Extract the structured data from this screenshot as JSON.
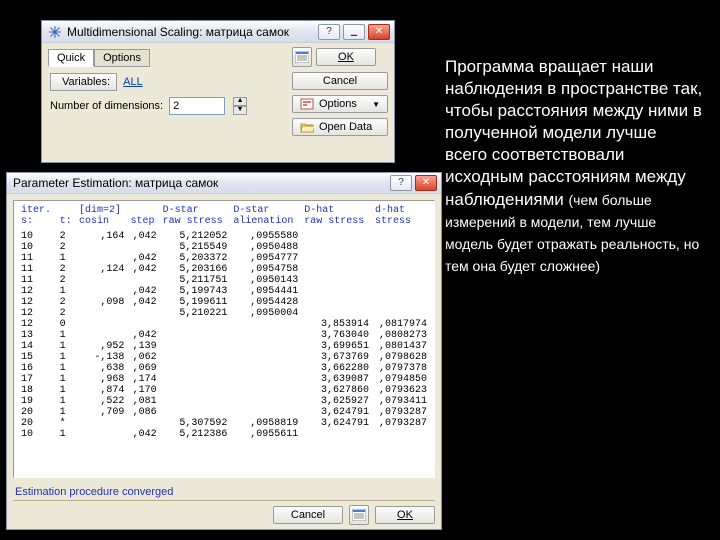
{
  "slide": {
    "text_main": "Программа вращает наши наблюдения в пространстве так, чтобы расстояния между ними в полученной модели лучше всего соответствовали исходным расстояниям между наблюдениями ",
    "text_small": "(чем больше измерений в модели, тем лучше модель будет отражать реальность, но тем она будет сложнее)"
  },
  "dlg1": {
    "title": "Multidimensional Scaling: матрица самок",
    "tabs": {
      "quick": "Quick",
      "options": "Options"
    },
    "variables_btn": "Variables:",
    "variables_value": "ALL",
    "numdim_label": "Number of dimensions:",
    "numdim_value": "2",
    "ok": "OK",
    "cancel": "Cancel",
    "options_btn": "Options",
    "open_data": "Open Data",
    "help": "?",
    "minimize": "▁",
    "close": "✕"
  },
  "dlg2": {
    "title": "Parameter Estimation: матрица самок",
    "help": "?",
    "close": "✕",
    "headers": {
      "iter": "iter.",
      "dim": "[dim=2]",
      "dstar1": "D-star",
      "dstar2": "D-star",
      "dhat1": "D-hat",
      "dhat2": "d-hat",
      "s": "s:",
      "t": "t:",
      "cosin": "cosin",
      "step": "step",
      "raw1": "raw stress",
      "alien": "alienation",
      "raw2": "raw stress",
      "stress": "stress"
    },
    "rows": [
      {
        "s": "10",
        "t": "2",
        "cos": ",164",
        "step": ",042",
        "r1": "5,212052",
        "al": ",0955580",
        "r2": "",
        "st": ""
      },
      {
        "s": "10",
        "t": "2",
        "cos": "",
        "step": "",
        "r1": "5,215549",
        "al": ",0950488",
        "r2": "",
        "st": ""
      },
      {
        "s": "11",
        "t": "1",
        "cos": "",
        "step": ",042",
        "r1": "5,203372",
        "al": ",0954777",
        "r2": "",
        "st": ""
      },
      {
        "s": "11",
        "t": "2",
        "cos": ",124",
        "step": ",042",
        "r1": "5,203166",
        "al": ",0954758",
        "r2": "",
        "st": ""
      },
      {
        "s": "11",
        "t": "2",
        "cos": "",
        "step": "",
        "r1": "5,211751",
        "al": ",0950143",
        "r2": "",
        "st": ""
      },
      {
        "s": "12",
        "t": "1",
        "cos": "",
        "step": ",042",
        "r1": "5,199743",
        "al": ",0954441",
        "r2": "",
        "st": ""
      },
      {
        "s": "12",
        "t": "2",
        "cos": ",098",
        "step": ",042",
        "r1": "5,199611",
        "al": ",0954428",
        "r2": "",
        "st": ""
      },
      {
        "s": "12",
        "t": "2",
        "cos": "",
        "step": "",
        "r1": "5,210221",
        "al": ",0950004",
        "r2": "",
        "st": ""
      },
      {
        "s": "12",
        "t": "0",
        "cos": "",
        "step": "",
        "r1": "",
        "al": "",
        "r2": "3,853914",
        "st": ",0817974"
      },
      {
        "s": "13",
        "t": "1",
        "cos": "",
        "step": ",042",
        "r1": "",
        "al": "",
        "r2": "3,763040",
        "st": ",0808273"
      },
      {
        "s": "14",
        "t": "1",
        "cos": ",952",
        "step": ",139",
        "r1": "",
        "al": "",
        "r2": "3,699651",
        "st": ",0801437"
      },
      {
        "s": "15",
        "t": "1",
        "cos": "-,138",
        "step": ",062",
        "r1": "",
        "al": "",
        "r2": "3,673769",
        "st": ",0798628"
      },
      {
        "s": "16",
        "t": "1",
        "cos": ",638",
        "step": ",069",
        "r1": "",
        "al": "",
        "r2": "3,662280",
        "st": ",0797378"
      },
      {
        "s": "17",
        "t": "1",
        "cos": ",968",
        "step": ",174",
        "r1": "",
        "al": "",
        "r2": "3,639087",
        "st": ",0794850"
      },
      {
        "s": "18",
        "t": "1",
        "cos": ",874",
        "step": ",170",
        "r1": "",
        "al": "",
        "r2": "3,627860",
        "st": ",0793623"
      },
      {
        "s": "19",
        "t": "1",
        "cos": ",522",
        "step": ",081",
        "r1": "",
        "al": "",
        "r2": "3,625927",
        "st": ",0793411"
      },
      {
        "s": "20",
        "t": "1",
        "cos": ",709",
        "step": ",086",
        "r1": "",
        "al": "",
        "r2": "3,624791",
        "st": ",0793287"
      },
      {
        "s": "20",
        "t": "*",
        "cos": "",
        "step": "",
        "r1": "5,307592",
        "al": ",0958819",
        "r2": "3,624791",
        "st": ",0793287"
      },
      {
        "s": "",
        "t": "",
        "cos": "",
        "step": "",
        "r1": "",
        "al": "",
        "r2": "",
        "st": ""
      },
      {
        "s": "10",
        "t": "1",
        "cos": "",
        "step": ",042",
        "r1": "5,212386",
        "al": ",0955611",
        "r2": "",
        "st": ""
      }
    ],
    "status": "Estimation procedure converged",
    "cancel": "Cancel",
    "ok": "OK"
  }
}
